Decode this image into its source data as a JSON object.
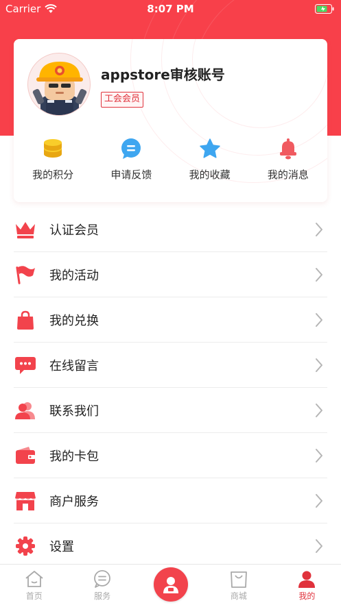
{
  "status_bar": {
    "carrier": "Carrier",
    "time": "8:07 PM"
  },
  "profile": {
    "username": "appstore审核账号",
    "badge": "工会会员"
  },
  "quick_actions": [
    {
      "label": "我的积分",
      "icon": "coins-icon",
      "color": "#f6c21a"
    },
    {
      "label": "申请反馈",
      "icon": "feedback-bubble-icon",
      "color": "#3ea6f0"
    },
    {
      "label": "我的收藏",
      "icon": "star-icon",
      "color": "#3ea6f0"
    },
    {
      "label": "我的消息",
      "icon": "bell-icon",
      "color": "#f05a60"
    }
  ],
  "menu": [
    {
      "label": "认证会员",
      "icon": "crown-icon"
    },
    {
      "label": "我的活动",
      "icon": "flag-icon"
    },
    {
      "label": "我的兑换",
      "icon": "shopping-bag-icon"
    },
    {
      "label": "在线留言",
      "icon": "message-icon"
    },
    {
      "label": "联系我们",
      "icon": "contacts-icon"
    },
    {
      "label": "我的卡包",
      "icon": "wallet-icon"
    },
    {
      "label": "商户服务",
      "icon": "store-icon"
    },
    {
      "label": "设置",
      "icon": "settings-gear-icon"
    }
  ],
  "tabbar": [
    {
      "label": "首页",
      "icon": "home-icon",
      "active": false
    },
    {
      "label": "服务",
      "icon": "service-icon",
      "active": false
    },
    {
      "label": "",
      "icon": "worker-center-icon",
      "active": false
    },
    {
      "label": "商城",
      "icon": "mall-bag-icon",
      "active": false
    },
    {
      "label": "我的",
      "icon": "user-profile-icon",
      "active": true
    }
  ],
  "colors": {
    "brand_red": "#f8404a",
    "accent_red": "#e0323c"
  }
}
